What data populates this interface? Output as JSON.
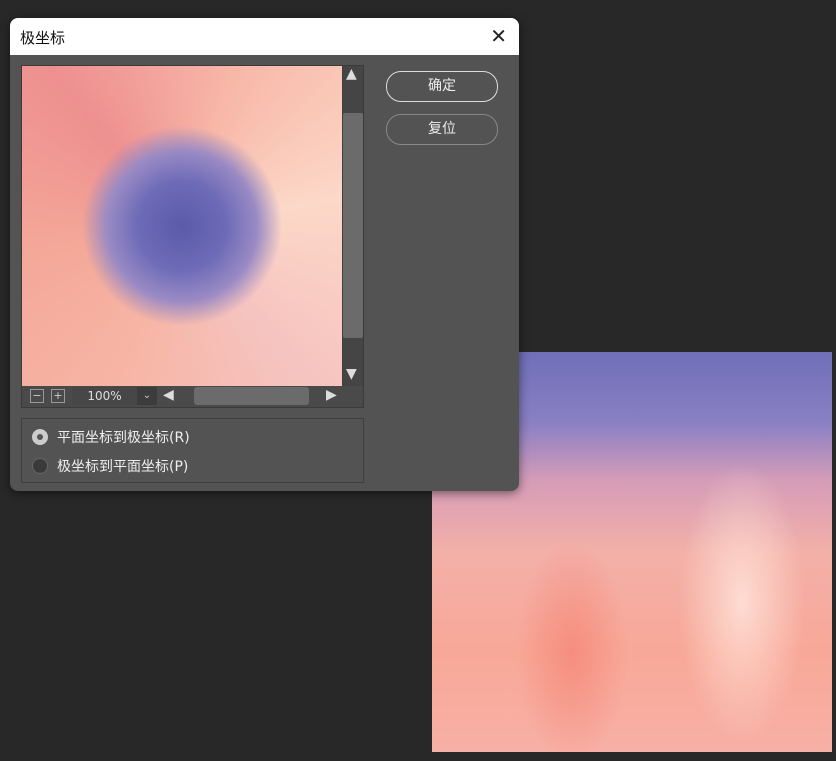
{
  "dialog": {
    "title": "极坐标",
    "close_icon": "close-icon"
  },
  "preview": {
    "zoom": "100%",
    "zoom_out": "−",
    "zoom_in": "+",
    "dropdown": "⌄"
  },
  "buttons": {
    "ok": "确定",
    "reset": "复位"
  },
  "options": [
    {
      "label": "平面坐标到极坐标(R)",
      "selected": true
    },
    {
      "label": "极坐标到平面坐标(P)",
      "selected": false
    }
  ]
}
